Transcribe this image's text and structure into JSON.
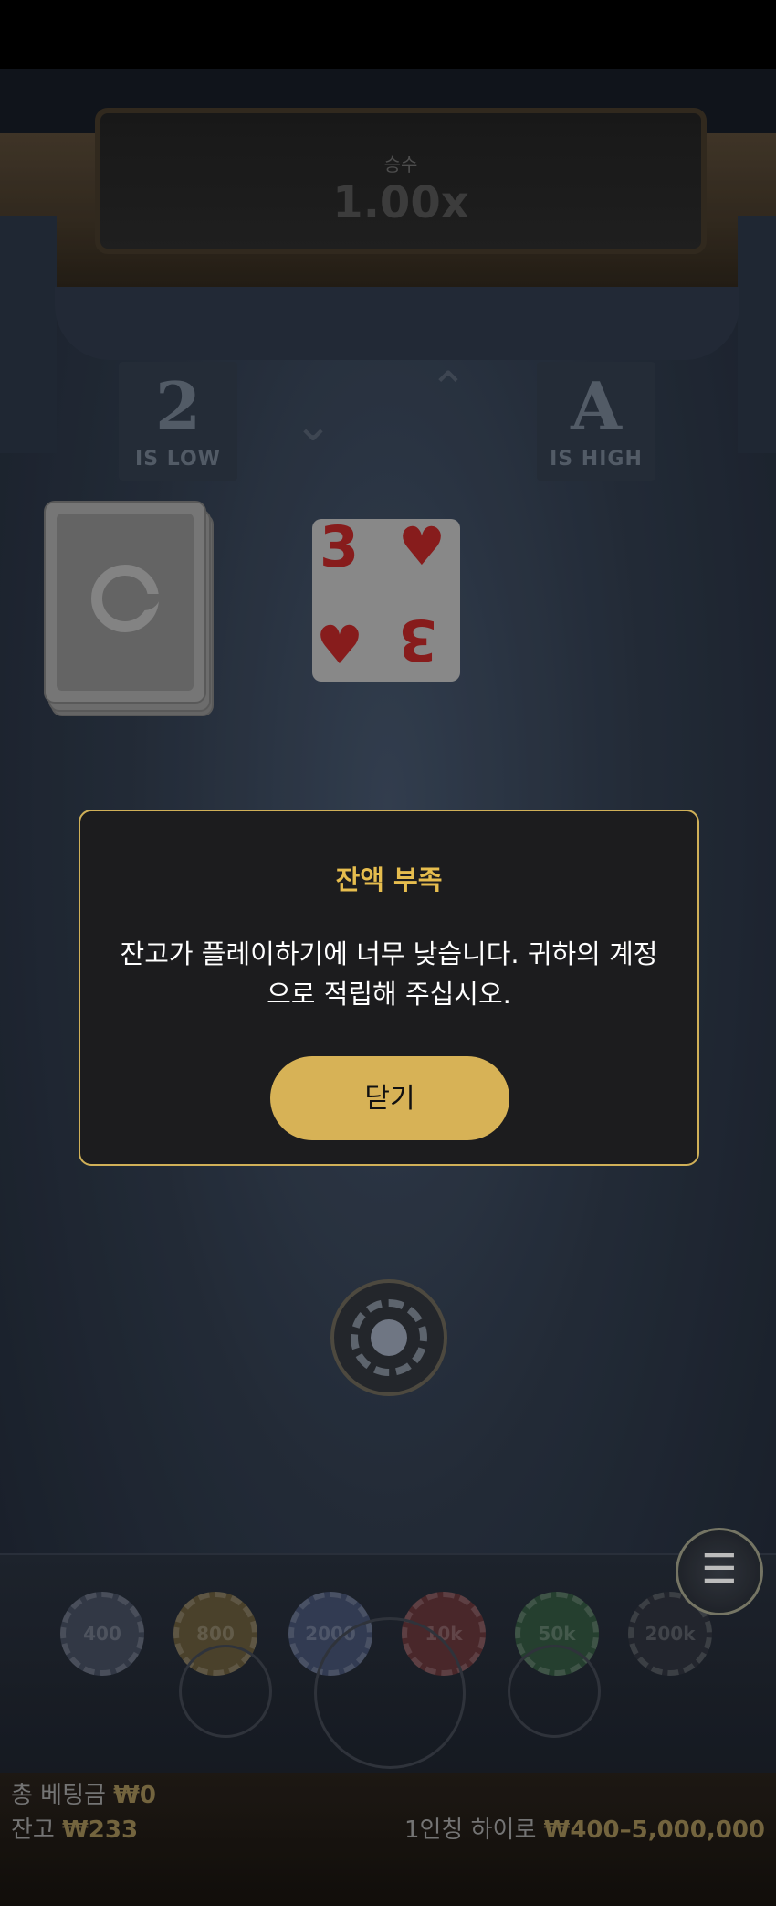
{
  "multiplier": {
    "label": "승수",
    "value": "1.00x"
  },
  "hints": {
    "low": {
      "rank": "2",
      "text": "IS LOW"
    },
    "high": {
      "rank": "A",
      "text": "IS HIGH"
    }
  },
  "current_card": {
    "rank": "3",
    "suit": "hearts",
    "suit_symbol": "♥"
  },
  "chips": [
    "400",
    "800",
    "2000",
    "10k",
    "50k",
    "200k"
  ],
  "footer": {
    "total_bet_label": "총 베팅금",
    "total_bet_value": "₩0",
    "balance_label": "잔고",
    "balance_value": "₩233",
    "limits_label": "1인칭 하이로",
    "limits_value": "₩400–5,000,000"
  },
  "modal": {
    "title": "잔액 부족",
    "message": "잔고가 플레이하기에 너무 낮습니다. 귀하의 계정으로 적립해 주십시오.",
    "close_label": "닫기"
  },
  "icons": {
    "menu": "hamburger-icon",
    "chevron_down": "chevron-down-icon",
    "chevron_up": "chevron-up-icon"
  },
  "colors": {
    "accent_gold": "#d7b256",
    "title_gold": "#e6bd4e",
    "card_red": "#a52323"
  }
}
